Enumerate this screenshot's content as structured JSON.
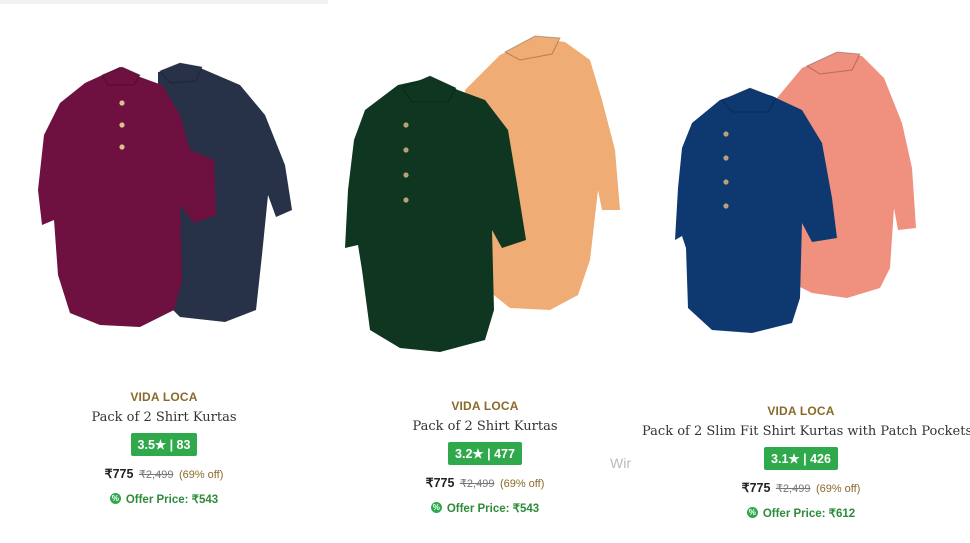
{
  "products": [
    {
      "brand": "VIDA LOCA",
      "title": "Pack of 2 Shirt Kurtas",
      "rating": "3.5★ | 83",
      "price": "₹775",
      "mrp": "₹2,499",
      "discount": "(69% off)",
      "offer": "Offer Price: ₹543",
      "colors": {
        "front": "#6e1040",
        "back": "#273248"
      }
    },
    {
      "brand": "VIDA LOCA",
      "title": "Pack of 2 Shirt Kurtas",
      "rating": "3.2★ | 477",
      "price": "₹775",
      "mrp": "₹2,499",
      "discount": "(69% off)",
      "offer": "Offer Price: ₹543",
      "colors": {
        "front": "#0f3620",
        "back": "#efac74"
      }
    },
    {
      "brand": "VIDA LOCA",
      "title": "Pack of 2 Slim Fit Shirt Kurtas with Patch Pockets",
      "rating": "3.1★ | 426",
      "price": "₹775",
      "mrp": "₹2,499",
      "discount": "(69% off)",
      "offer": "Offer Price: ₹612",
      "colors": {
        "front": "#0e3970",
        "back": "#f0907f"
      }
    }
  ],
  "watermark_text": "Wir",
  "accent_green": "#2fa94b",
  "brand_color": "#8a6a2a"
}
